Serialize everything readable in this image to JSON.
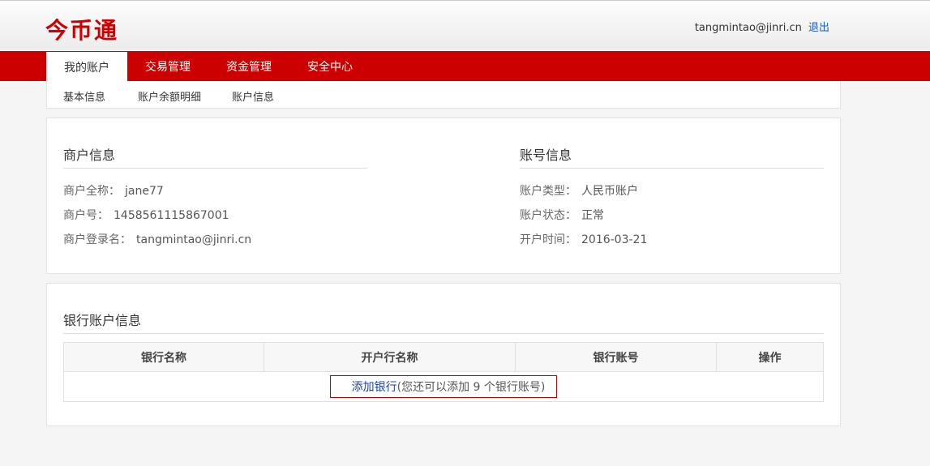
{
  "header": {
    "logo": "今币通",
    "user_email": "tangmintao@jinri.cn",
    "logout_label": "退出"
  },
  "nav": {
    "items": [
      {
        "label": "我的账户"
      },
      {
        "label": "交易管理"
      },
      {
        "label": "资金管理"
      },
      {
        "label": "安全中心"
      }
    ]
  },
  "subnav": {
    "items": [
      {
        "label": "基本信息"
      },
      {
        "label": "账户余额明细"
      },
      {
        "label": "账户信息"
      }
    ]
  },
  "merchant": {
    "title": "商户信息",
    "full_name_label": "商户全称：",
    "full_name": "jane77",
    "id_label": "商户号：",
    "id": "1458561115867001",
    "login_label": "商户登录名：",
    "login": "tangmintao@jinri.cn"
  },
  "account": {
    "title": "账号信息",
    "type_label": "账户类型：",
    "type": "人民币账户",
    "status_label": "账户状态：",
    "status": "正常",
    "opened_label": "开户时间：",
    "opened": "2016-03-21"
  },
  "bank": {
    "title": "银行账户信息",
    "columns": [
      "银行名称",
      "开户行名称",
      "银行账号",
      "操作"
    ],
    "add_link": "添加银行",
    "add_note": "(您还可以添加 9 个银行账号)"
  }
}
